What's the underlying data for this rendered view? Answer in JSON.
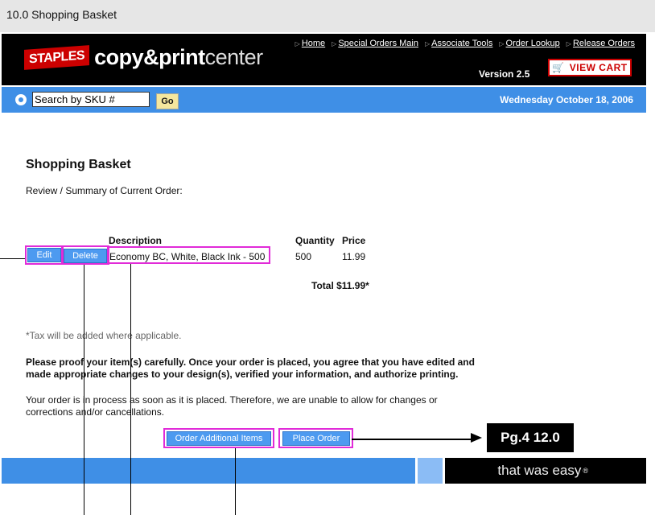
{
  "doc": {
    "section_title": "10.0 Shopping Basket"
  },
  "header": {
    "brand_badge": "STAPLES",
    "brand_bold": "copy&print",
    "brand_light": "center",
    "links": [
      "Home",
      "Special Orders Main",
      "Associate Tools",
      "Order Lookup",
      "Release Orders"
    ],
    "version": "Version 2.5",
    "view_cart": "VIEW CART"
  },
  "search": {
    "value": "Search by SKU #",
    "go_label": "Go",
    "date": "Wednesday October 18, 2006"
  },
  "main": {
    "title": "Shopping Basket",
    "review": "Review / Summary of Current Order:",
    "columns": {
      "description": "Description",
      "quantity": "Quantity",
      "price": "Price"
    },
    "item": {
      "edit_label": "Edit",
      "delete_label": "Delete",
      "description": "Economy BC, White, Black Ink - 500",
      "quantity": "500",
      "price": "11.99"
    },
    "total": "Total $11.99*",
    "tax_note": "*Tax will be added where applicable.",
    "proof_note": "Please proof your item(s) carefully. Once your order is placed, you agree that you have edited and made appropriate changes to your design(s), verified your information, and authorize printing.",
    "process_note": "Your order is in process as soon as it is placed. Therefore, we are unable to allow for changes or corrections and/or cancellations.",
    "order_additional_label": "Order Additional Items",
    "place_order_label": "Place Order"
  },
  "footer": {
    "tagline": "that was easy"
  },
  "annotation": {
    "callout": "Pg.4 12.0"
  },
  "colors": {
    "accent_blue": "#3f8fe6",
    "highlight": "#e12bd8",
    "brand_red": "#cc0000"
  }
}
